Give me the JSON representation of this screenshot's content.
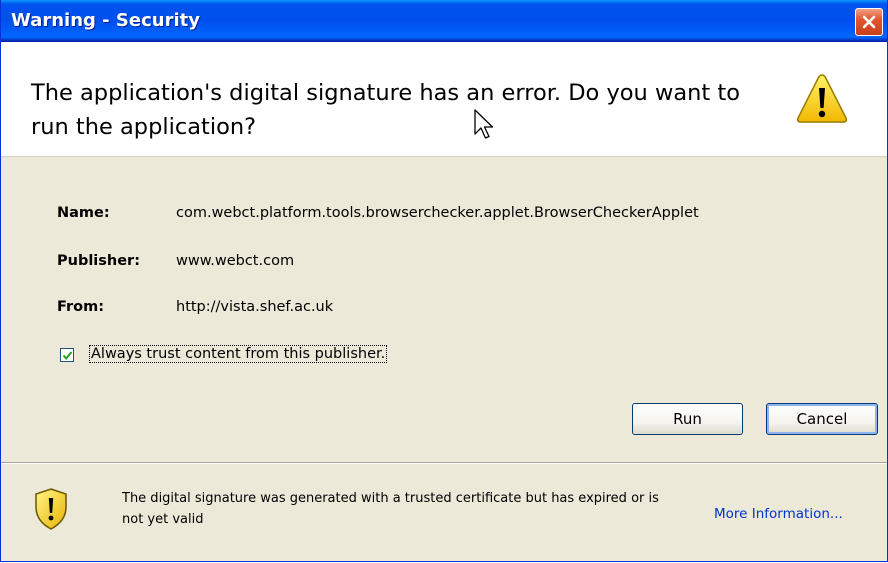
{
  "window": {
    "title": "Warning - Security"
  },
  "header": {
    "message": "The application's digital signature has an error.  Do you want to run the application?"
  },
  "details": {
    "name_label": "Name:",
    "name_value": "com.webct.platform.tools.browserchecker.applet.BrowserCheckerApplet",
    "publisher_label": "Publisher:",
    "publisher_value": "www.webct.com",
    "from_label": "From:",
    "from_value": "http://vista.shef.ac.uk"
  },
  "trust": {
    "label": "Always trust content from this publisher.",
    "checked": true
  },
  "buttons": {
    "run_label": "Run",
    "cancel_label": "Cancel"
  },
  "footer": {
    "message": "The digital signature was generated with a trusted certificate but has expired or is not yet valid",
    "more_info_label": "More Information..."
  },
  "colors": {
    "titlebar": "#0053ee",
    "dialog_background": "#ece9d8",
    "link": "#0033cc",
    "warning_yellow": "#f8d200"
  },
  "icons": [
    "close-icon",
    "warning-triangle-icon",
    "mouse-cursor-icon",
    "checkmark-icon",
    "warning-shield-icon"
  ]
}
